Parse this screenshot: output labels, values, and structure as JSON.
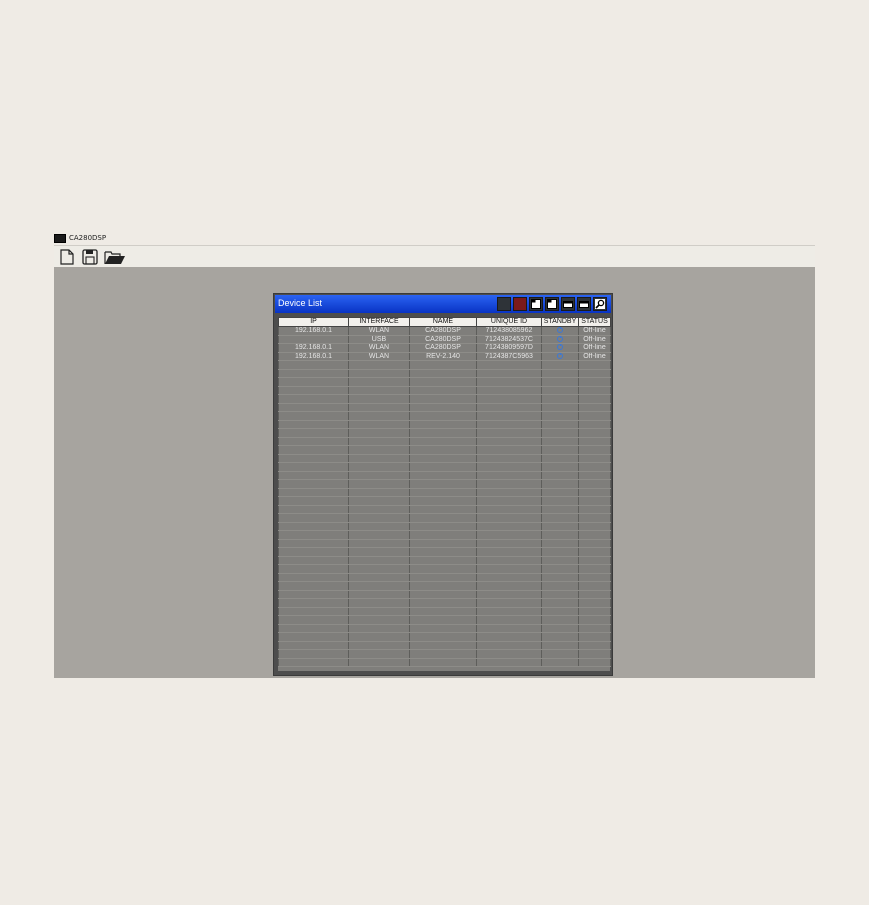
{
  "app": {
    "title": "CA280DSP"
  },
  "toolbar": {
    "buttons": [
      {
        "icon": "new-file-icon"
      },
      {
        "icon": "save-icon"
      },
      {
        "icon": "open-folder-icon"
      }
    ]
  },
  "device_list": {
    "title": "Device List",
    "columns": [
      "IP",
      "INTERFACE",
      "NAME",
      "UNIQUE ID",
      "STANDBY",
      "STATUS"
    ],
    "rows": [
      {
        "ip": "192.168.0.1",
        "interface": "WLAN",
        "name": "CA280DSP",
        "unique_id": "712438085962",
        "standby": "power-icon",
        "status": "Off-line"
      },
      {
        "ip": "",
        "interface": "USB",
        "name": "CA280DSP",
        "unique_id": "71243824537C",
        "standby": "power-icon",
        "status": "Off-line"
      },
      {
        "ip": "192.168.0.1",
        "interface": "WLAN",
        "name": "CA280DSP",
        "unique_id": "71243809597D",
        "standby": "power-icon",
        "status": "Off-line"
      },
      {
        "ip": "192.168.0.1",
        "interface": "WLAN",
        "name": "REV-2.140",
        "unique_id": "7124387C5963",
        "standby": "power-icon",
        "status": "Off-line"
      }
    ],
    "empty_rows": 36,
    "window_buttons": [
      "dark-square-icon",
      "red-square-icon",
      "window-icon",
      "window-icon",
      "minimize-icon",
      "minimize-icon",
      "search-icon"
    ]
  },
  "colors": {
    "titlebar": "#0a3dcc",
    "workspace": "#a7a49f",
    "grid": "#7f7e7b"
  }
}
